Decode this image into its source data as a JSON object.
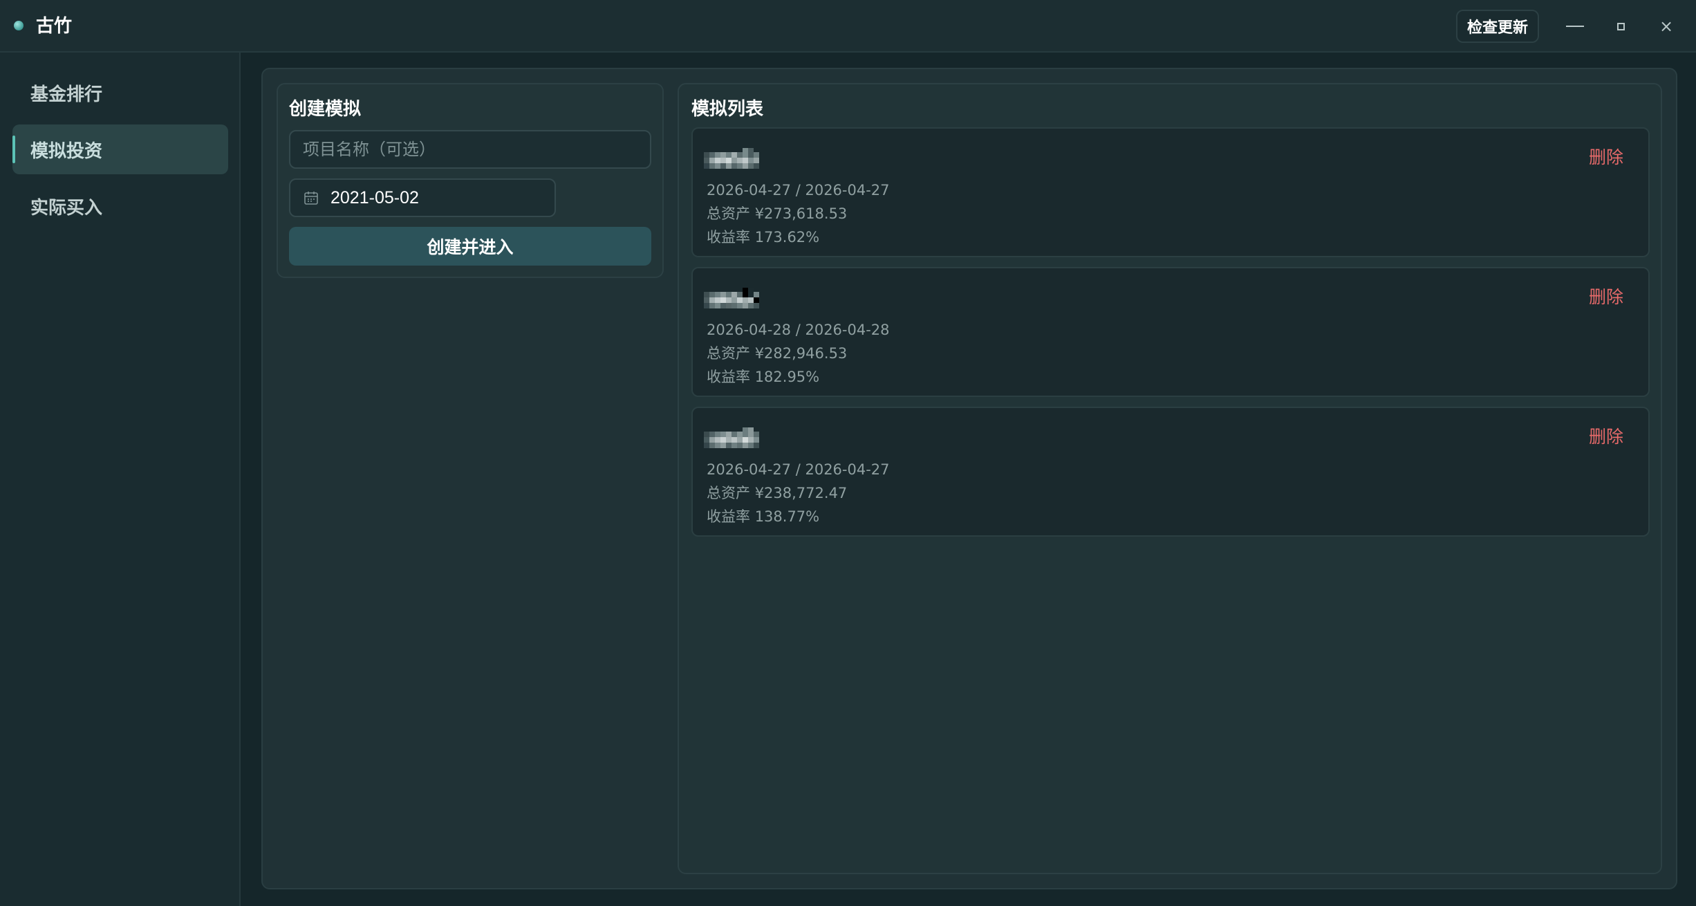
{
  "app": {
    "title": "古竹",
    "check_update_label": "检查更新"
  },
  "window_controls": {
    "minimize": "minimize",
    "maximize": "maximize",
    "close": "×"
  },
  "sidebar": {
    "items": [
      {
        "label": "基金排行",
        "active": false
      },
      {
        "label": "模拟投资",
        "active": true
      },
      {
        "label": "实际买入",
        "active": false
      }
    ]
  },
  "create": {
    "heading": "创建模拟",
    "name_placeholder": "项目名称（可选）",
    "name_value": "",
    "date_value": "2021-05-02",
    "submit_label": "创建并进入"
  },
  "list": {
    "heading": "模拟列表",
    "items": [
      {
        "dates": "2026-04-27 / 2026-04-27",
        "assets_label": "总资产",
        "assets": "¥273,618.53",
        "return_label": "收益率",
        "return": "173.62%",
        "delete_label": "删除"
      },
      {
        "dates": "2026-04-28 / 2026-04-28",
        "assets_label": "总资产",
        "assets": "¥282,946.53",
        "return_label": "收益率",
        "return": "182.95%",
        "delete_label": "删除"
      },
      {
        "dates": "2026-04-27 / 2026-04-27",
        "assets_label": "总资产",
        "assets": "¥238,772.47",
        "return_label": "收益率",
        "return": "138.77%",
        "delete_label": "删除"
      }
    ]
  },
  "colors": {
    "accent": "#5cc3b6",
    "danger": "#e86a6a",
    "primary_button": "#2c535a"
  }
}
